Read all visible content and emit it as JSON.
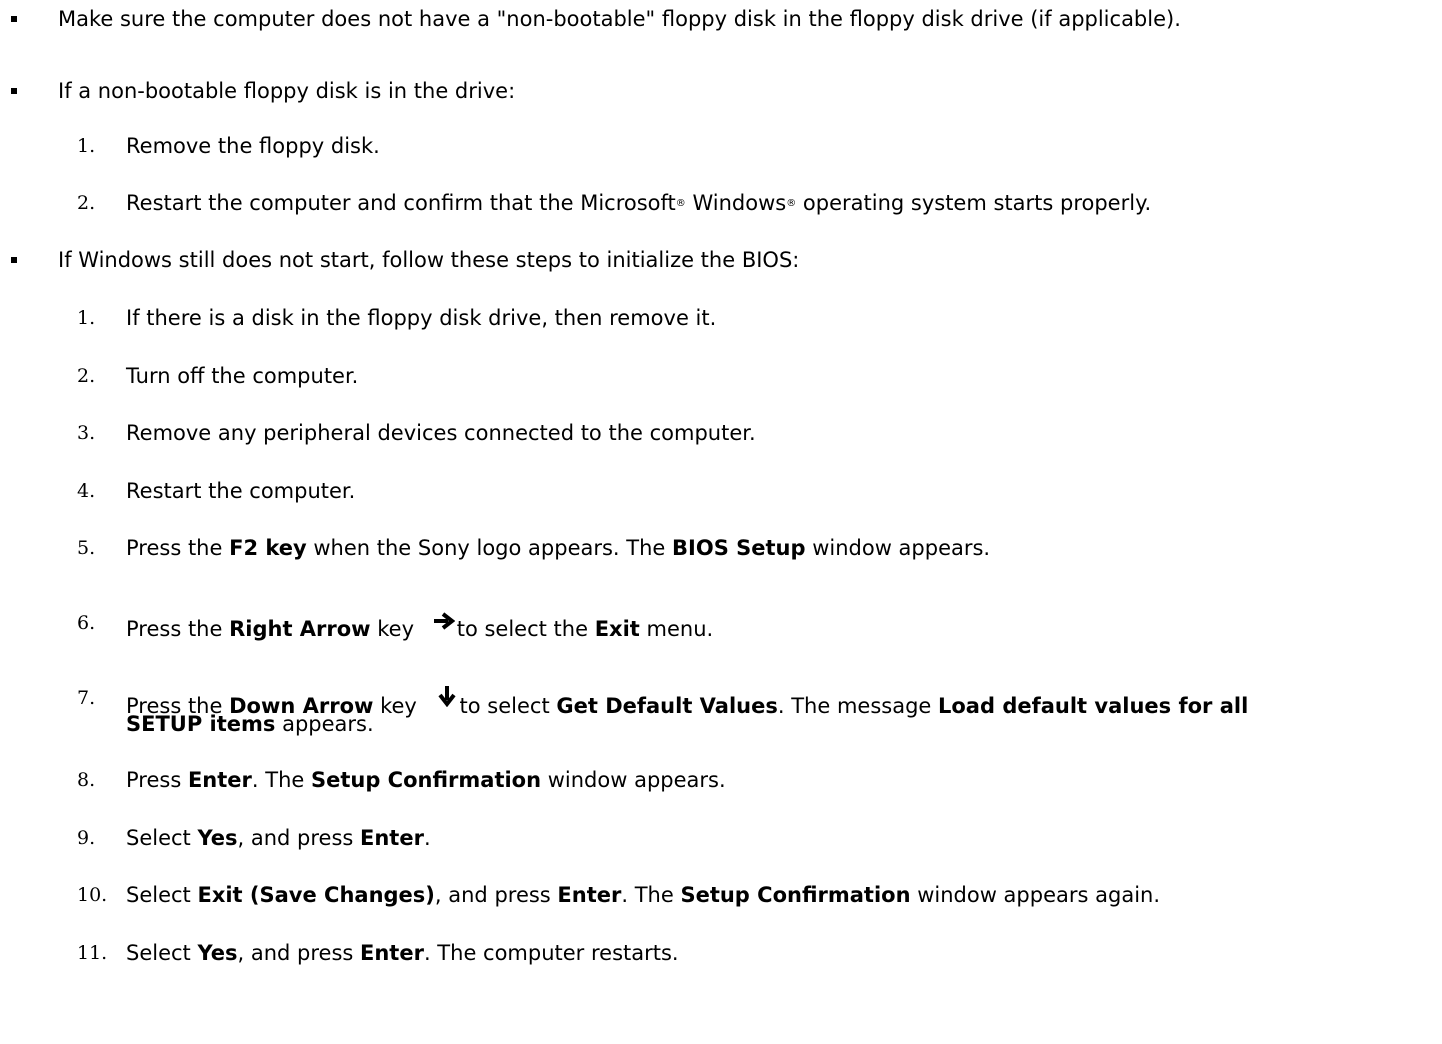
{
  "bullets": [
    {
      "text": "Make sure the computer does not have a \"non-bootable\" floppy disk in the floppy disk drive (if applicable)."
    },
    {
      "text": "If a non-bootable floppy disk is in the drive:"
    },
    {
      "text": "If Windows still does not start, follow these steps to initialize the BIOS:"
    }
  ],
  "list_a": [
    {
      "num": "1.",
      "text": "Remove the floppy disk."
    },
    {
      "num": "2.",
      "pre": "Restart the computer and confirm that the Microsoft",
      "reg1": "®",
      "mid": " Windows",
      "reg2": "®",
      "post": " operating system starts properly."
    }
  ],
  "list_b": [
    {
      "num": "1.",
      "text": "If there is a disk in the floppy disk drive, then remove it."
    },
    {
      "num": "2.",
      "text": "Turn off the computer."
    },
    {
      "num": "3.",
      "text": "Remove any peripheral devices connected to the computer."
    },
    {
      "num": "4.",
      "text": "Restart the computer."
    },
    {
      "num": "5.",
      "t1": "Press the ",
      "b1": "F2 key",
      "t2": " when the Sony logo appears. The ",
      "b2": "BIOS Setup",
      "t3": " window appears."
    },
    {
      "num": "6.",
      "t1": "Press the ",
      "b1": "Right Arrow",
      "t2": " key",
      "t3": "to select the ",
      "b2": "Exit",
      "t4": " menu."
    },
    {
      "num": "7.",
      "t1": "Press the ",
      "b1": "Down Arrow",
      "t2": " key",
      "t3": "to select ",
      "b2": "Get Default Values",
      "t4": ". The message ",
      "b3": "Load default values for all",
      "b4": "SETUP items",
      "t5": " appears."
    },
    {
      "num": "8.",
      "t1": "Press ",
      "b1": "Enter",
      "t2": ". The ",
      "b2": "Setup Confirmation",
      "t3": " window appears."
    },
    {
      "num": "9.",
      "t1": "Select ",
      "b1": "Yes",
      "t2": ", and press ",
      "b2": "Enter",
      "t3": "."
    },
    {
      "num": "10.",
      "t1": "Select ",
      "b1": "Exit (Save Changes)",
      "t2": ", and press ",
      "b2": "Enter",
      "t3": ". The ",
      "b3": "Setup Confirmation",
      "t4": " window appears again."
    },
    {
      "num": "11.",
      "t1": "Select ",
      "b1": "Yes",
      "t2": ", and press ",
      "b2": "Enter",
      "t3": ". The computer restarts."
    }
  ],
  "icons": {
    "right": "right-arrow-icon",
    "down": "down-arrow-icon"
  }
}
